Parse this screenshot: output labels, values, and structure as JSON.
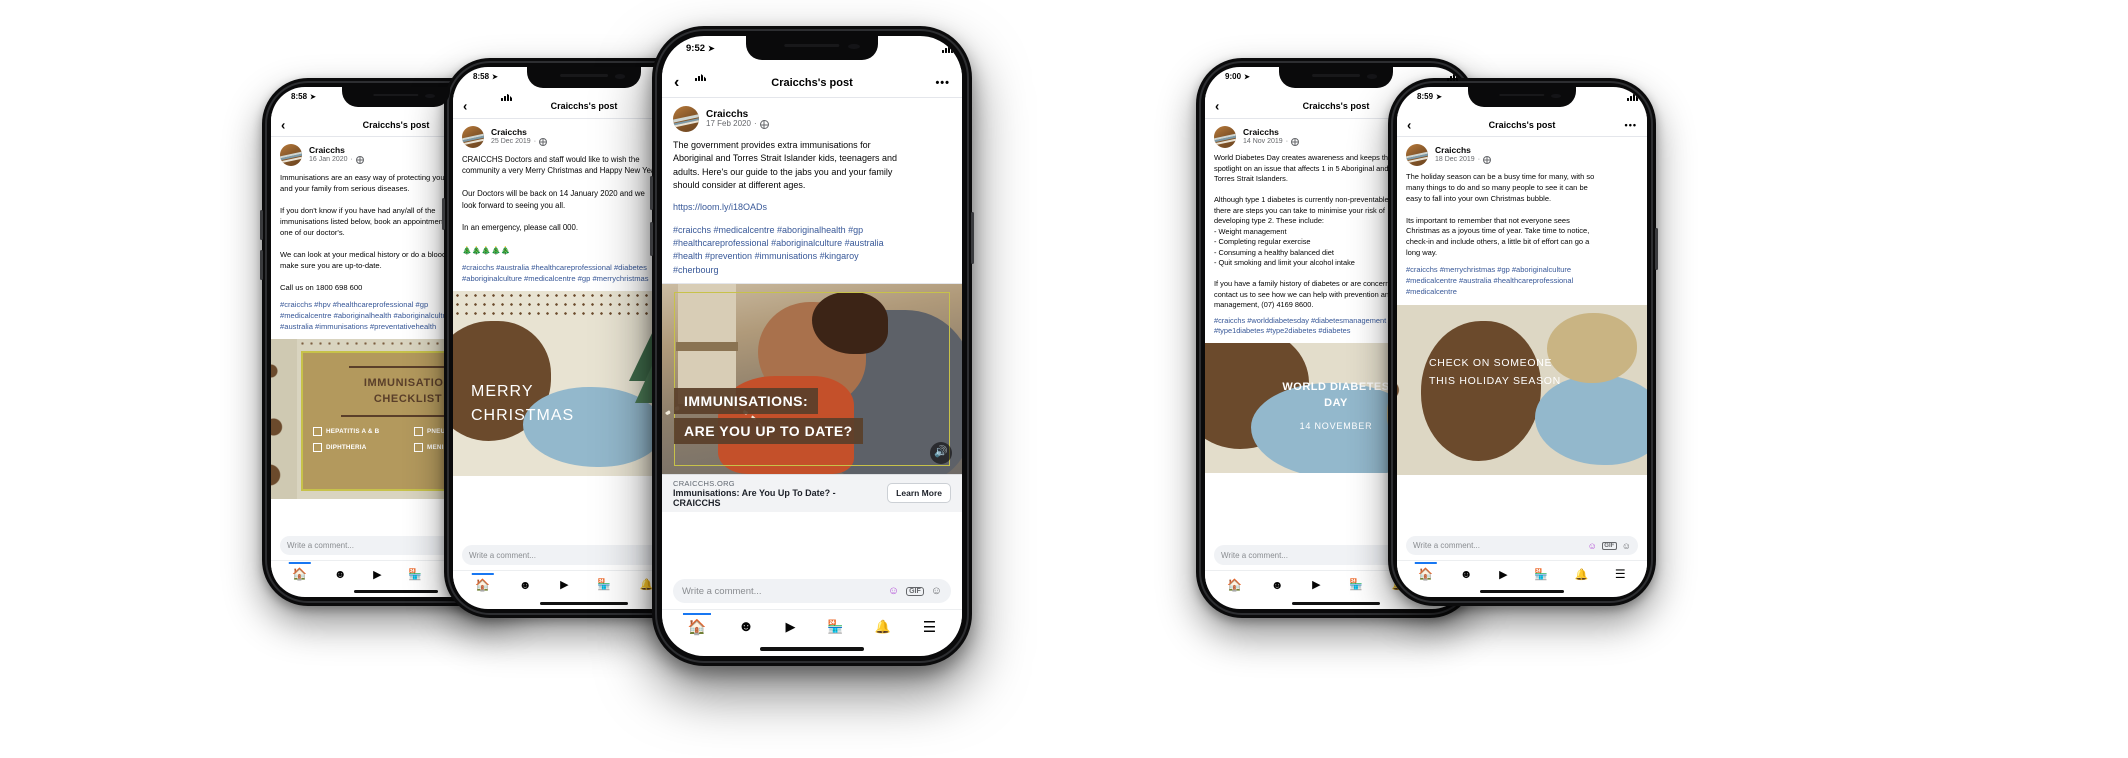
{
  "scene": {
    "title": "Craicchs Facebook post mockups on five iPhones",
    "background": "#ffffff",
    "accent_blue": "#1877f2",
    "link_blue": "#385898",
    "brand_brown": "#5a3f2a",
    "brand_tan": "#b3995d",
    "brand_olive": "#c7c24a"
  },
  "common": {
    "nav_title": "Craicchs's post",
    "back_icon": "chevron-left-icon",
    "more_icon": "more-horizontal-icon",
    "author": "Craicchs",
    "privacy_icon": "globe-icon",
    "comment_placeholder": "Write a comment...",
    "comment_icons": [
      "sticker-icon",
      "GIF",
      "emoji-icon"
    ],
    "tabs": [
      {
        "name": "home",
        "icon": "home-icon",
        "active": true
      },
      {
        "name": "groups",
        "icon": "groups-icon",
        "active": false
      },
      {
        "name": "watch",
        "icon": "video-icon",
        "active": false
      },
      {
        "name": "marketplace",
        "icon": "store-icon",
        "active": false
      },
      {
        "name": "notifications",
        "icon": "bell-icon",
        "active": false
      },
      {
        "name": "menu",
        "icon": "hamburger-icon",
        "active": false
      }
    ]
  },
  "phones": [
    {
      "id": "phone-1-immunisation-checklist",
      "status_time": "8:58",
      "location_icon": "location-arrow-icon",
      "date": "16 Jan 2020",
      "body": "Immunisations are an easy way of protecting yourself\nand your family from serious diseases.\n\nIf you don't know if you have had any/all of the\nimmunisations listed below, book an appointment with\none of our doctor's.\n\nWe can look at your medical history or do a blood test to\nmake sure you are up-to-date.\n\nCall us on 1800 698 600",
      "tags": "#craicchs #hpv #healthcareprofessional #gp\n#medicalcentre #aboriginalhealth #aboriginalculture\n#australia #immunisations #preventativehealth",
      "art": {
        "style": "checklist-poster",
        "title_line1": "IMMUNISATION",
        "title_line2": "CHECKLIST",
        "items_left": [
          "HEPATITIS A & B",
          "DIPHTHERIA"
        ],
        "items_right": [
          "PNEUMOCOCCAL",
          "MENINGOCOCCAL"
        ]
      }
    },
    {
      "id": "phone-2-merry-christmas",
      "status_time": "8:58",
      "location_icon": "location-arrow-icon",
      "date": "25 Dec 2019",
      "body": "CRAICCHS Doctors and staff would like to wish the\ncommunity a very Merry Christmas and Happy New Year.\n\nOur Doctors will be back on 14 January 2020 and we\nlook forward to seeing you all.\n\nIn an emergency, please call 000.\n\n🎄🎄🎄🎄🎄",
      "tags": "#craicchs #australia #healthcareprofessional #diabetes\n#aboriginalculture #medicalcentre #gp #merrychristmas",
      "art": {
        "style": "christmas-poster",
        "title_line1": "MERRY",
        "title_line2": "CHRISTMAS"
      }
    },
    {
      "id": "phone-3-immunisations-up-to-date",
      "status_time": "9:52",
      "location_icon": "location-arrow-icon",
      "date": "17 Feb 2020",
      "body": "The government provides extra immunisations for\nAboriginal and Torres Strait Islander kids, teenagers and\nadults. Here's our guide to the jabs you and your family\nshould consider at different ages.",
      "link": "https://loom.ly/i18OADs",
      "tags": "#craicchs #medicalcentre #aboriginalhealth #gp\n#healthcareprofessional #aboriginalculture #australia\n#health #prevention #immunisations #kingaroy\n#cherbourg",
      "art": {
        "style": "baby-photo",
        "caption_line1": "IMMUNISATIONS:",
        "caption_line2": "ARE YOU UP TO DATE?",
        "audio_icon": "speaker-icon"
      },
      "link_card": {
        "host": "CRAICCHS.ORG",
        "title": "Immunisations: Are You Up To Date? - CRAICCHS",
        "cta": "Learn More"
      }
    },
    {
      "id": "phone-4-world-diabetes-day",
      "status_time": "9:00",
      "location_icon": "location-arrow-icon",
      "date": "14 Nov 2019",
      "body": "World Diabetes Day creates awareness and keeps the\nspotlight on an issue that affects 1 in 5 Aboriginal and/or\nTorres Strait Islanders.\n\nAlthough type 1 diabetes is currently non-preventable,\nthere are steps you can take to minimise your risk of\ndeveloping type 2. These include:\n- Weight management\n- Completing regular exercise\n- Consuming a healthy balanced diet\n- Quit smoking and limit your alcohol intake\n\nIf you have a family history of diabetes or are concerned\ncontact us to see how we can help with prevention and\nmanagement, (07) 4169 8600.",
      "tags": "#craicchs #worlddiabetesday #diabetesmanagement\n#type1diabetes #type2diabetes #diabetes",
      "art": {
        "style": "diabetes-poster",
        "title_line1": "WORLD DIABETES",
        "title_line2": "DAY",
        "subtitle": "14 NOVEMBER"
      }
    },
    {
      "id": "phone-5-check-on-someone",
      "status_time": "8:59",
      "location_icon": "location-arrow-icon",
      "date": "18 Dec 2019",
      "body": "The holiday season can be a busy time for many, with so\nmany things to do and so many people to see it can be\neasy to fall into your own Christmas bubble.\n\nIts important to remember that not everyone sees\nChristmas as a joyous time of year. Take time to notice,\ncheck-in and include others, a little bit of effort can go a\nlong way.",
      "tags": "#craicchs #merrychristmas #gp #aboriginalculture\n#medicalcentre #australia #healthcareprofessional\n#medicalcentre",
      "art": {
        "style": "check-on-someone-poster",
        "title_line1": "CHECK ON SOMEONE",
        "title_line2": "THIS HOLIDAY SEASON"
      }
    }
  ]
}
